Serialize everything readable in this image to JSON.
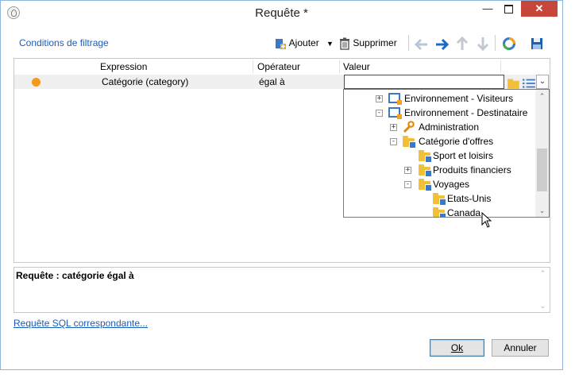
{
  "window": {
    "title": "Requête *"
  },
  "toolbar": {
    "tab_label": "Conditions de filtrage",
    "add_label": "Ajouter",
    "delete_label": "Supprimer"
  },
  "grid": {
    "columns": [
      "Expression",
      "Opérateur",
      "Valeur"
    ],
    "row": {
      "expression": "Catégorie (category)",
      "operator": "égal à",
      "value": ""
    }
  },
  "tree": {
    "items": [
      {
        "label": "Environnement - Visiteurs",
        "icon": "environment-icon",
        "toggle": "+"
      },
      {
        "label": "Environnement - Destinataire",
        "icon": "environment-icon",
        "toggle": "-"
      },
      {
        "label": "Administration",
        "icon": "wrench-icon",
        "toggle": "+"
      },
      {
        "label": "Catégorie d'offres",
        "icon": "folder-icon",
        "toggle": "-"
      },
      {
        "label": "Sport et loisirs",
        "icon": "folder-icon",
        "toggle": ""
      },
      {
        "label": "Produits financiers",
        "icon": "folder-icon",
        "toggle": "+"
      },
      {
        "label": "Voyages",
        "icon": "folder-icon",
        "toggle": "-"
      },
      {
        "label": "Etats-Unis",
        "icon": "folder-icon",
        "toggle": ""
      },
      {
        "label": "Canada",
        "icon": "folder-icon",
        "toggle": ""
      }
    ]
  },
  "query": {
    "text": "Requête : catégorie égal à"
  },
  "links": {
    "sql_label": "Requête SQL correspondante..."
  },
  "buttons": {
    "ok_label": "Ok",
    "cancel_label": "Annuler"
  },
  "colors": {
    "accent": "#1c5cb6",
    "close": "#c7463a",
    "folder": "#f2c037",
    "status_dot": "#f29a1b"
  }
}
